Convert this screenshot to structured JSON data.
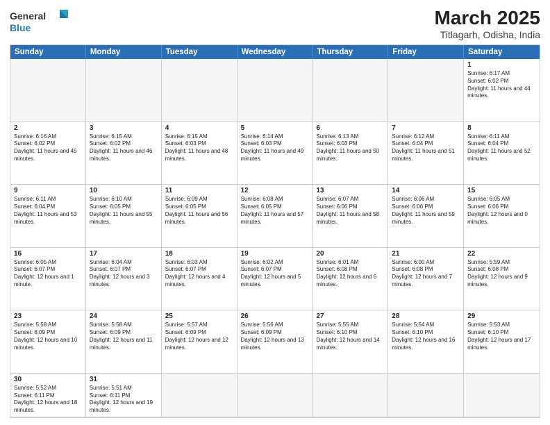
{
  "header": {
    "logo_general": "General",
    "logo_blue": "Blue",
    "month": "March 2025",
    "location": "Titlagarh, Odisha, India"
  },
  "days": [
    "Sunday",
    "Monday",
    "Tuesday",
    "Wednesday",
    "Thursday",
    "Friday",
    "Saturday"
  ],
  "cells": [
    {
      "date": "",
      "empty": true
    },
    {
      "date": "",
      "empty": true
    },
    {
      "date": "",
      "empty": true
    },
    {
      "date": "",
      "empty": true
    },
    {
      "date": "",
      "empty": true
    },
    {
      "date": "",
      "empty": true
    },
    {
      "date": "1",
      "sunrise": "6:17 AM",
      "sunset": "6:02 PM",
      "daylight": "11 hours and 44 minutes."
    },
    {
      "date": "2",
      "sunrise": "6:16 AM",
      "sunset": "6:02 PM",
      "daylight": "11 hours and 45 minutes."
    },
    {
      "date": "3",
      "sunrise": "6:15 AM",
      "sunset": "6:02 PM",
      "daylight": "11 hours and 46 minutes."
    },
    {
      "date": "4",
      "sunrise": "6:15 AM",
      "sunset": "6:03 PM",
      "daylight": "11 hours and 48 minutes."
    },
    {
      "date": "5",
      "sunrise": "6:14 AM",
      "sunset": "6:03 PM",
      "daylight": "11 hours and 49 minutes."
    },
    {
      "date": "6",
      "sunrise": "6:13 AM",
      "sunset": "6:03 PM",
      "daylight": "11 hours and 50 minutes."
    },
    {
      "date": "7",
      "sunrise": "6:12 AM",
      "sunset": "6:04 PM",
      "daylight": "11 hours and 51 minutes."
    },
    {
      "date": "8",
      "sunrise": "6:11 AM",
      "sunset": "6:04 PM",
      "daylight": "11 hours and 52 minutes."
    },
    {
      "date": "9",
      "sunrise": "6:11 AM",
      "sunset": "6:04 PM",
      "daylight": "11 hours and 53 minutes."
    },
    {
      "date": "10",
      "sunrise": "6:10 AM",
      "sunset": "6:05 PM",
      "daylight": "11 hours and 55 minutes."
    },
    {
      "date": "11",
      "sunrise": "6:09 AM",
      "sunset": "6:05 PM",
      "daylight": "11 hours and 56 minutes."
    },
    {
      "date": "12",
      "sunrise": "6:08 AM",
      "sunset": "6:05 PM",
      "daylight": "11 hours and 57 minutes."
    },
    {
      "date": "13",
      "sunrise": "6:07 AM",
      "sunset": "6:06 PM",
      "daylight": "11 hours and 58 minutes."
    },
    {
      "date": "14",
      "sunrise": "6:06 AM",
      "sunset": "6:06 PM",
      "daylight": "11 hours and 59 minutes."
    },
    {
      "date": "15",
      "sunrise": "6:05 AM",
      "sunset": "6:06 PM",
      "daylight": "12 hours and 0 minutes."
    },
    {
      "date": "16",
      "sunrise": "6:05 AM",
      "sunset": "6:07 PM",
      "daylight": "12 hours and 1 minute."
    },
    {
      "date": "17",
      "sunrise": "6:04 AM",
      "sunset": "6:07 PM",
      "daylight": "12 hours and 3 minutes."
    },
    {
      "date": "18",
      "sunrise": "6:03 AM",
      "sunset": "6:07 PM",
      "daylight": "12 hours and 4 minutes."
    },
    {
      "date": "19",
      "sunrise": "6:02 AM",
      "sunset": "6:07 PM",
      "daylight": "12 hours and 5 minutes."
    },
    {
      "date": "20",
      "sunrise": "6:01 AM",
      "sunset": "6:08 PM",
      "daylight": "12 hours and 6 minutes."
    },
    {
      "date": "21",
      "sunrise": "6:00 AM",
      "sunset": "6:08 PM",
      "daylight": "12 hours and 7 minutes."
    },
    {
      "date": "22",
      "sunrise": "5:59 AM",
      "sunset": "6:08 PM",
      "daylight": "12 hours and 9 minutes."
    },
    {
      "date": "23",
      "sunrise": "5:58 AM",
      "sunset": "6:09 PM",
      "daylight": "12 hours and 10 minutes."
    },
    {
      "date": "24",
      "sunrise": "5:58 AM",
      "sunset": "6:09 PM",
      "daylight": "12 hours and 11 minutes."
    },
    {
      "date": "25",
      "sunrise": "5:57 AM",
      "sunset": "6:09 PM",
      "daylight": "12 hours and 12 minutes."
    },
    {
      "date": "26",
      "sunrise": "5:56 AM",
      "sunset": "6:09 PM",
      "daylight": "12 hours and 13 minutes."
    },
    {
      "date": "27",
      "sunrise": "5:55 AM",
      "sunset": "6:10 PM",
      "daylight": "12 hours and 14 minutes."
    },
    {
      "date": "28",
      "sunrise": "5:54 AM",
      "sunset": "6:10 PM",
      "daylight": "12 hours and 16 minutes."
    },
    {
      "date": "29",
      "sunrise": "5:53 AM",
      "sunset": "6:10 PM",
      "daylight": "12 hours and 17 minutes."
    },
    {
      "date": "30",
      "sunrise": "5:52 AM",
      "sunset": "6:11 PM",
      "daylight": "12 hours and 18 minutes."
    },
    {
      "date": "31",
      "sunrise": "5:51 AM",
      "sunset": "6:11 PM",
      "daylight": "12 hours and 19 minutes."
    },
    {
      "date": "",
      "empty": true
    },
    {
      "date": "",
      "empty": true
    },
    {
      "date": "",
      "empty": true
    },
    {
      "date": "",
      "empty": true
    },
    {
      "date": "",
      "empty": true
    }
  ]
}
